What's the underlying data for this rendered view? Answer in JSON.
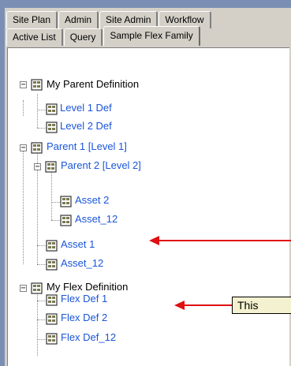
{
  "tabs": {
    "row1": [
      {
        "label": "Site Plan"
      },
      {
        "label": "Admin"
      },
      {
        "label": "Site Admin"
      },
      {
        "label": "Workflow"
      }
    ],
    "row2": [
      {
        "label": "Active List"
      },
      {
        "label": "Query"
      },
      {
        "label": "Sample Flex Family",
        "active": true
      }
    ]
  },
  "tree": {
    "nodes": [
      {
        "label": "My Parent Definition",
        "color": "black"
      },
      {
        "label": "Level 1 Def",
        "color": "blue"
      },
      {
        "label": "Level 2 Def",
        "color": "blue"
      },
      {
        "label": "Parent 1 [Level 1]",
        "color": "blue"
      },
      {
        "label": "Parent 2 [Level 2]",
        "color": "blue"
      },
      {
        "label": "Asset 2",
        "color": "blue"
      },
      {
        "label": "Asset_12",
        "color": "blue"
      },
      {
        "label": "Asset 1",
        "color": "blue"
      },
      {
        "label": "Asset_12",
        "color": "blue"
      },
      {
        "label": "My Flex Definition",
        "color": "black"
      },
      {
        "label": "Flex Def 1",
        "color": "blue"
      },
      {
        "label": "Flex Def 2",
        "color": "blue"
      },
      {
        "label": "Flex Def_12",
        "color": "blue"
      }
    ]
  },
  "callout": {
    "text": "This"
  },
  "colors": {
    "link_blue": "#1a55d9",
    "arrow_red": "#e01010",
    "panel_gray": "#d4d0c8",
    "frame_blue": "#7a8fb3"
  }
}
